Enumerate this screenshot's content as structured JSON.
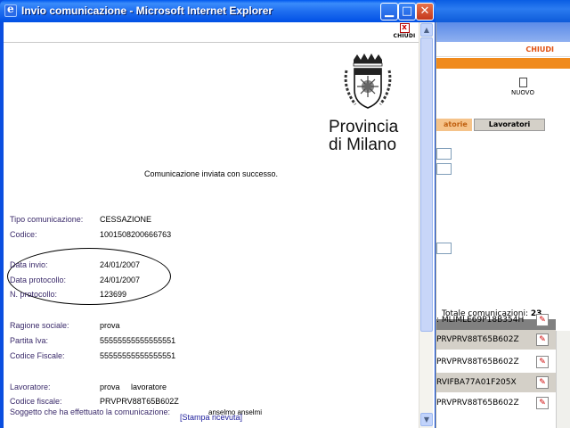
{
  "window": {
    "title": "Invio comunicazione - Microsoft Internet Explorer",
    "chiudi_label": "CHIUDI"
  },
  "logo": {
    "line1": "Provincia",
    "line2": "di Milano"
  },
  "message": "Comunicazione inviata con successo.",
  "fields": {
    "tipo_label": "Tipo comunicazione:",
    "tipo_value": "CESSAZIONE",
    "codice_label": "Codice:",
    "codice_value": "1001508200666763",
    "data_invio_label": "Data invio:",
    "data_invio_value": "24/01/2007",
    "data_protocollo_label": "Data protocollo:",
    "data_protocollo_value": "24/01/2007",
    "n_protocollo_label": "N. protocollo:",
    "n_protocollo_value": "123699",
    "ragione_label": "Ragione sociale:",
    "ragione_value": "prova",
    "partita_label": "Partita Iva:",
    "partita_value": "55555555555555551",
    "cf_label": "Codice Fiscale:",
    "cf_value": "55555555555555551",
    "lavoratore_label": "Lavoratore:",
    "lavoratore_value": "prova     lavoratore",
    "lav_cf_label": "Codice fiscale:",
    "lav_cf_value": "PRVPRV88T65B602Z",
    "soggetto_label": "Soggetto che ha effettuato la comunicazione:",
    "soggetto_value": "anselmo anselmi"
  },
  "stampa_label": "[Stampa ricevuta]",
  "background_window": {
    "chiudi_label": "CHIUDI",
    "nuovo_label": "NUOVO",
    "tab_partial": "atorie",
    "tab_lavoratori": "Lavoratori",
    "totale_label": "Totale comunicazioni:",
    "totale_value": "23",
    "rows": [
      ": MLIMLE69P18B354H",
      "PRVPRV88T65B602Z",
      "PRVPRV88T65B602Z",
      "RVIFBA77A01F205X",
      "PRVPRV88T65B602Z"
    ]
  },
  "colors": {
    "titlebar": "#0a4ee0",
    "accent_orange": "#f08a1c",
    "label_text": "#3a2a6a",
    "link": "#1a1a9a"
  }
}
